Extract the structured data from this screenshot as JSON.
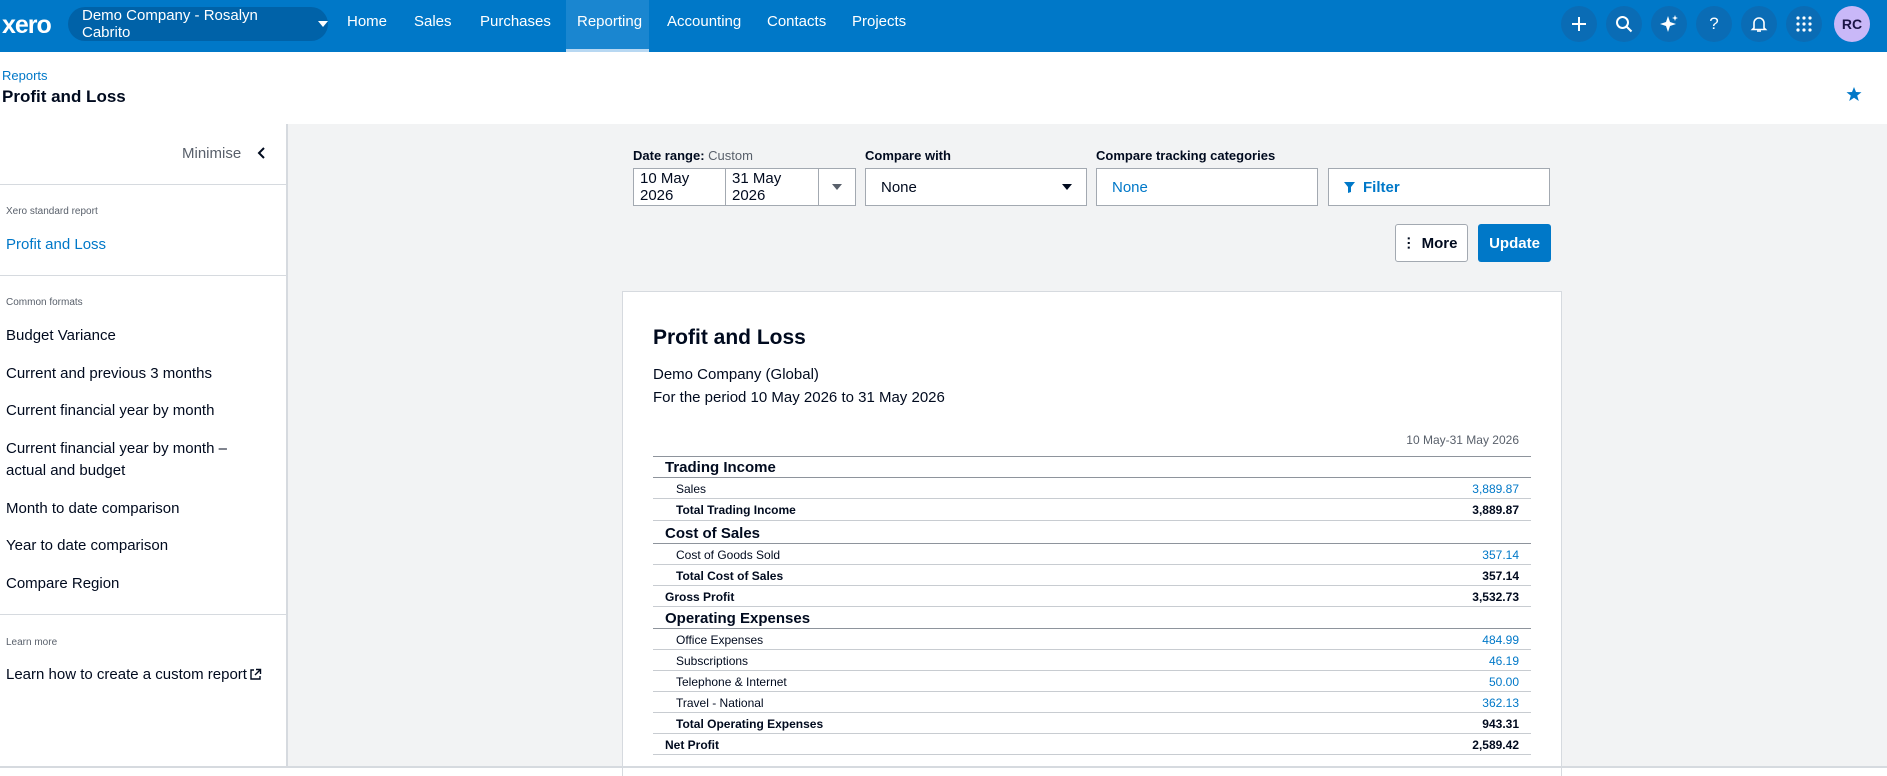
{
  "app": {
    "logo": "xero",
    "org_name": "Demo Company - Rosalyn Cabrito"
  },
  "nav": [
    {
      "label": "Home",
      "active": false
    },
    {
      "label": "Sales",
      "active": false
    },
    {
      "label": "Purchases",
      "active": false
    },
    {
      "label": "Reporting",
      "active": true
    },
    {
      "label": "Accounting",
      "active": false
    },
    {
      "label": "Contacts",
      "active": false
    },
    {
      "label": "Projects",
      "active": false
    }
  ],
  "header_icons": [
    "plus-icon",
    "search-icon",
    "sparkle-icon",
    "help-icon",
    "bell-icon",
    "apps-grid-icon"
  ],
  "user": {
    "initials": "RC"
  },
  "breadcrumb": "Reports",
  "page_title": "Profit and Loss",
  "sidebar": {
    "minimise_label": "Minimise",
    "standard_heading": "Xero standard report",
    "standard_item": "Profit and Loss",
    "formats_heading": "Common formats",
    "formats": [
      "Budget Variance",
      "Current and previous 3 months",
      "Current financial year by month",
      "Current financial year by month – actual and budget",
      "Month to date comparison",
      "Year to date comparison",
      "Compare Region"
    ],
    "learn_heading": "Learn more",
    "learn_item": "Learn how to create a custom report"
  },
  "controls": {
    "date_range_label": "Date range:",
    "date_range_type": "Custom",
    "date_from": "10 May 2026",
    "date_to": "31 May 2026",
    "compare_with_label": "Compare with",
    "compare_with_value": "None",
    "tracking_label": "Compare tracking categories",
    "tracking_value": "None",
    "filter_label": "Filter",
    "more_label": "More",
    "update_label": "Update"
  },
  "report": {
    "title": "Profit and Loss",
    "company": "Demo Company (Global)",
    "period": "For the period 10 May 2026 to 31 May 2026",
    "column_header": "10 May-31 May 2026",
    "rows": [
      {
        "kind": "section",
        "label": "Trading Income",
        "value": ""
      },
      {
        "kind": "item",
        "label": "Sales",
        "value": "3,889.87"
      },
      {
        "kind": "total",
        "label": "Total Trading Income",
        "value": "3,889.87"
      },
      {
        "kind": "section",
        "label": "Cost of Sales",
        "value": ""
      },
      {
        "kind": "item",
        "label": "Cost of Goods Sold",
        "value": "357.14"
      },
      {
        "kind": "total",
        "label": "Total Cost of Sales",
        "value": "357.14"
      },
      {
        "kind": "summary",
        "label": "Gross Profit",
        "value": "3,532.73"
      },
      {
        "kind": "section",
        "label": "Operating Expenses",
        "value": ""
      },
      {
        "kind": "item",
        "label": "Office Expenses",
        "value": "484.99"
      },
      {
        "kind": "item",
        "label": "Subscriptions",
        "value": "46.19"
      },
      {
        "kind": "item",
        "label": "Telephone & Internet",
        "value": "50.00"
      },
      {
        "kind": "item",
        "label": "Travel - National",
        "value": "362.13"
      },
      {
        "kind": "total",
        "label": "Total Operating Expenses",
        "value": "943.31"
      },
      {
        "kind": "summary",
        "label": "Net Profit",
        "value": "2,589.42"
      }
    ]
  },
  "colors": {
    "brand": "#0078c8",
    "link": "#0078c8",
    "avatar": "#c9b8f8"
  }
}
